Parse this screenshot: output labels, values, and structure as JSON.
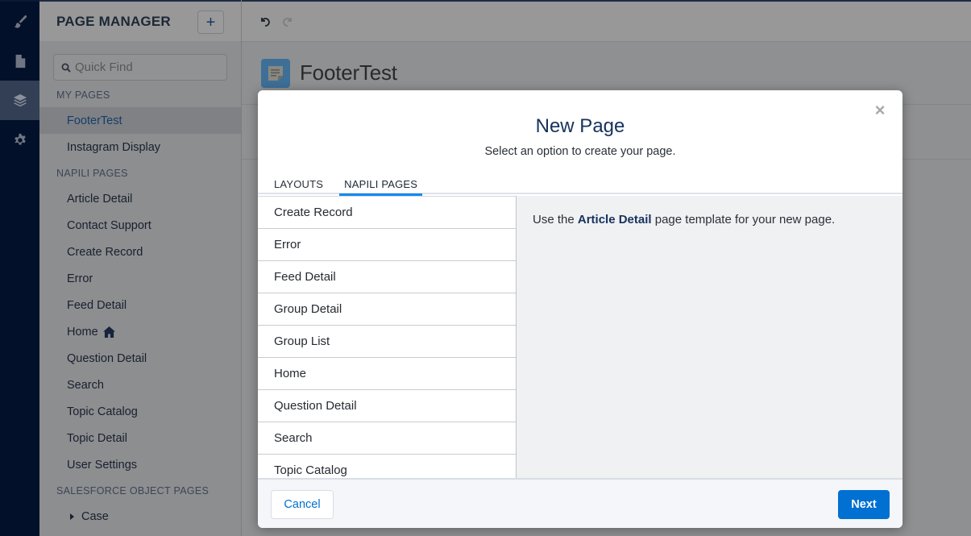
{
  "rail": {
    "items": [
      {
        "icon": "brush-icon",
        "active": false
      },
      {
        "icon": "page-icon",
        "active": false
      },
      {
        "icon": "layers-icon",
        "active": true
      },
      {
        "icon": "gear-icon",
        "active": false
      }
    ]
  },
  "sidebar": {
    "title": "PAGE MANAGER",
    "add_label": "+",
    "search_placeholder": "Quick Find",
    "sections": [
      {
        "label": "MY PAGES",
        "items": [
          "FooterTest",
          "Instagram Display"
        ],
        "selected": "FooterTest"
      },
      {
        "label": "NAPILI PAGES",
        "items": [
          "Article Detail",
          "Contact Support",
          "Create Record",
          "Error",
          "Feed Detail",
          "Home",
          "Question Detail",
          "Search",
          "Topic Catalog",
          "Topic Detail",
          "User Settings"
        ]
      },
      {
        "label": "SALESFORCE OBJECT PAGES",
        "items": [
          "Case"
        ]
      }
    ]
  },
  "main": {
    "page_title": "FooterTest"
  },
  "modal": {
    "title": "New Page",
    "subtitle": "Select an option to create your page.",
    "tabs": [
      "LAYOUTS",
      "NAPILI PAGES"
    ],
    "active_tab": "NAPILI PAGES",
    "templates": [
      "Create Record",
      "Error",
      "Feed Detail",
      "Group Detail",
      "Group List",
      "Home",
      "Question Detail",
      "Search",
      "Topic Catalog"
    ],
    "detail": {
      "prefix": "Use the ",
      "template_name": "Article Detail",
      "suffix": " page template for your new page."
    },
    "cancel_label": "Cancel",
    "next_label": "Next",
    "close_label": "×"
  },
  "colors": {
    "accent": "#0070d2",
    "tab_underline": "#1589ee",
    "title": "#16325c"
  }
}
